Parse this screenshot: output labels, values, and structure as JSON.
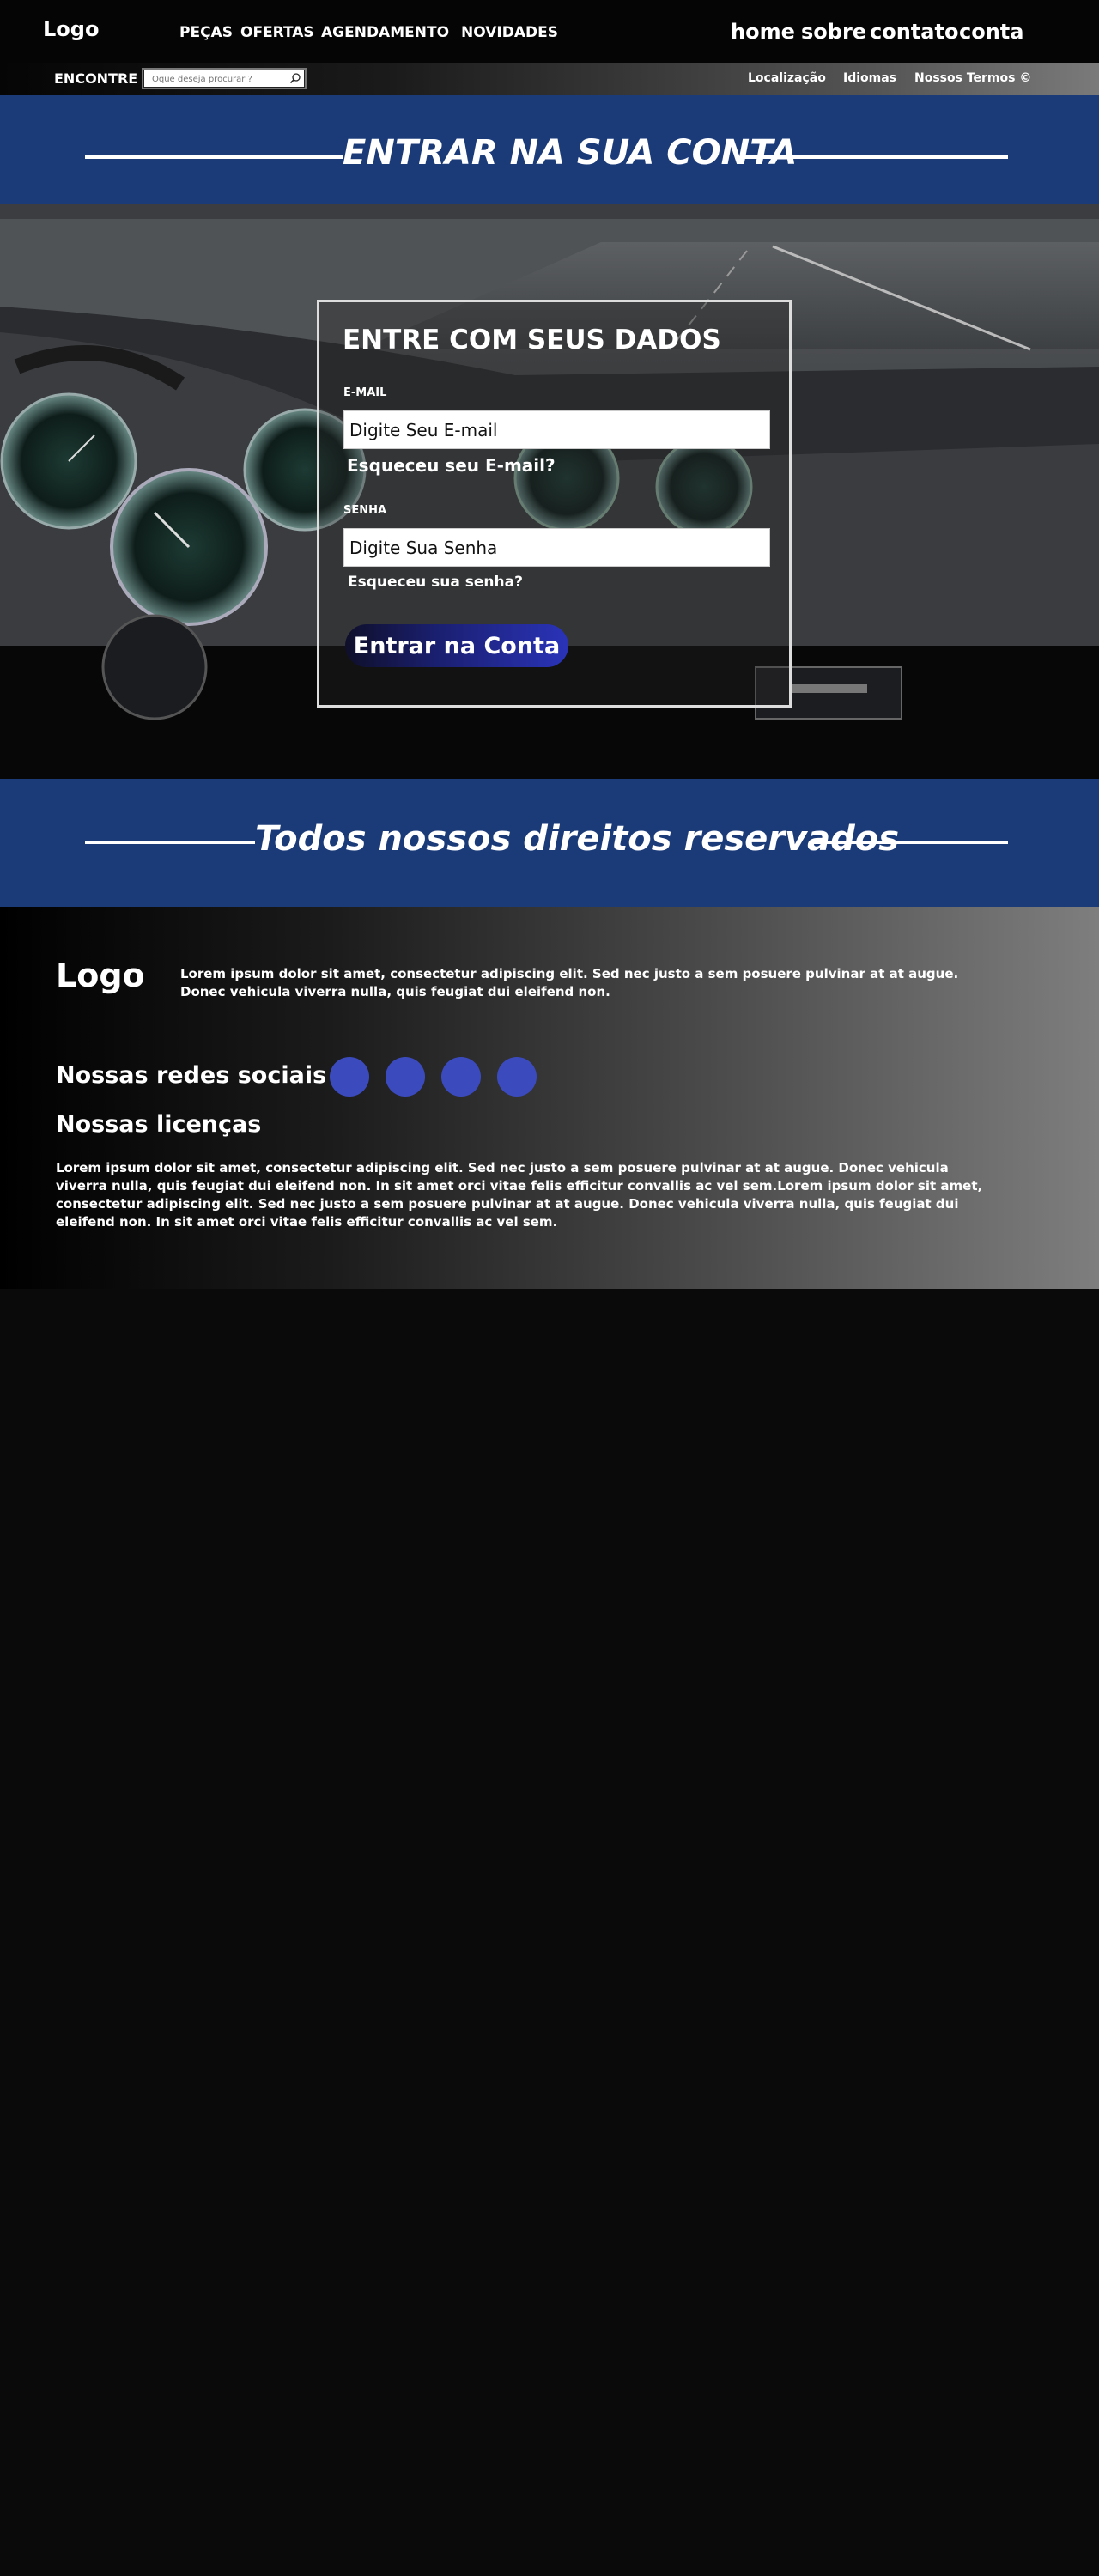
{
  "topnav": {
    "logo": "Logo",
    "left_items": [
      "PEÇAS",
      "OFERTAS",
      "AGENDAMENTO",
      "NOVIDADES"
    ],
    "right_items": [
      "home",
      "sobre",
      "contato",
      "conta"
    ]
  },
  "subnav": {
    "search_label": "ENCONTRE",
    "search_placeholder": "Oque deseja procurar ?",
    "links": [
      "Localização",
      "Idiomas",
      "Nossos Termos ©"
    ]
  },
  "banner_top": {
    "title": "ENTRAR NA  SUA CONTA"
  },
  "login": {
    "title": "ENTRE COM SEUS DADOS",
    "email_label": "E-MAIL",
    "email_placeholder": "Digite Seu E-mail",
    "email_forgot": "Esqueceu seu E-mail?",
    "password_label": "SENHA",
    "password_placeholder": "Digite Sua Senha",
    "password_forgot": "Esqueceu sua senha?",
    "submit": "Entrar na Conta"
  },
  "banner_bottom": {
    "title": "Todos nossos direitos reservados"
  },
  "footer": {
    "logo": "Logo",
    "about": "Lorem ipsum dolor sit amet, consectetur adipiscing elit. Sed nec justo a sem posuere pulvinar at at augue. Donec vehicula viverra nulla, quis feugiat dui eleifend non.",
    "social_title": "Nossas redes sociais",
    "license_title": "Nossas licenças",
    "license_text": "Lorem ipsum dolor sit amet, consectetur adipiscing elit. Sed nec justo a sem posuere pulvinar at at augue. Donec vehicula viverra nulla, quis feugiat dui eleifend non. In sit amet orci vitae felis efficitur convallis ac vel sem.Lorem ipsum dolor sit amet, consectetur adipiscing elit. Sed nec justo a sem posuere pulvinar at at augue. Donec vehicula viverra nulla, quis feugiat dui eleifend non. In sit amet orci vitae felis efficitur convallis ac vel sem."
  },
  "colors": {
    "banner_blue": "#1b3a78",
    "social_circle": "#3b4bbe",
    "button_accent": "#2a33b8"
  }
}
